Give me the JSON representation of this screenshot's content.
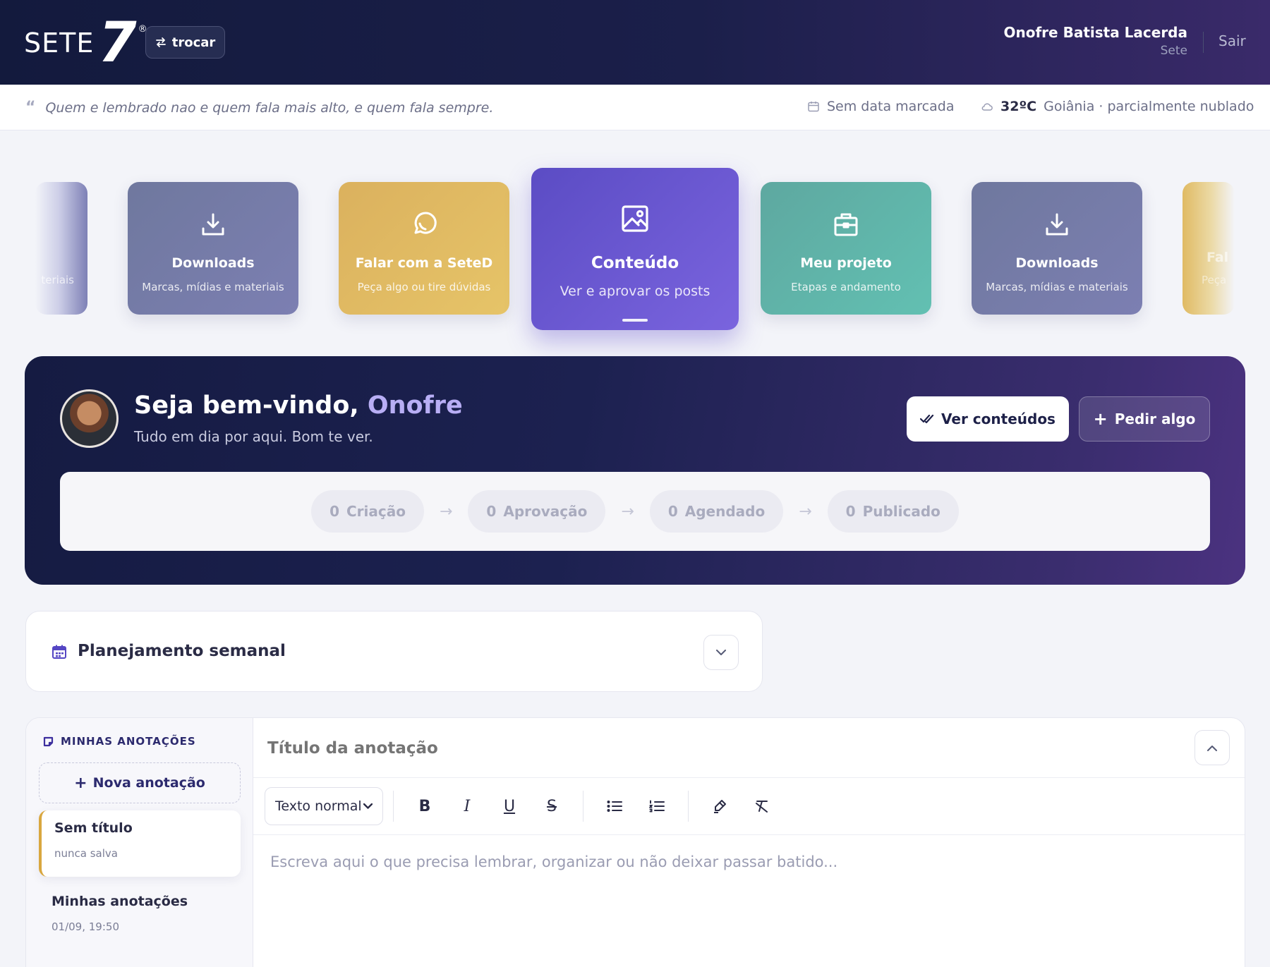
{
  "header": {
    "logo_text": "SETE",
    "logo_mark": "7",
    "logo_reg": "®",
    "switch_label": "trocar",
    "user_name": "Onofre Batista Lacerda",
    "user_company": "Sete",
    "logout_label": "Sair"
  },
  "info": {
    "quote": "Quem e lembrado nao e quem fala mais alto, e quem fala sempre.",
    "date": "Sem data marcada",
    "temperature": "32ºC",
    "weather": "Goiânia · parcialmente nublado"
  },
  "carousel": {
    "edge_left_sub": "teriais",
    "cards": [
      {
        "title": "Downloads",
        "subtitle": "Marcas, mídias e materiais",
        "icon": "download-icon",
        "color": "#737aa6"
      },
      {
        "title": "Falar com a SeteD",
        "subtitle": "Peça algo ou tire dúvidas",
        "icon": "whatsapp-icon",
        "color": "#e0bb63"
      },
      {
        "title": "Conteúdo",
        "subtitle": "Ver e aprovar os posts",
        "icon": "image-icon",
        "color": "#6a58d4"
      },
      {
        "title": "Meu projeto",
        "subtitle": "Etapas e andamento",
        "icon": "briefcase-icon",
        "color": "#5fb3a8"
      },
      {
        "title": "Downloads",
        "subtitle": "Marcas, mídias e materiais",
        "icon": "download-icon",
        "color": "#737aa6"
      }
    ],
    "edge_right_title": "Fal",
    "edge_right_sub": "Peça"
  },
  "hero": {
    "greeting": "Seja bem-vindo, ",
    "name": "Onofre",
    "subtitle": "Tudo em dia por aqui. Bom te ver.",
    "primary_button": "Ver conteúdos",
    "secondary_button": "Pedir algo",
    "pipeline": [
      {
        "count": "0",
        "label": "Criação"
      },
      {
        "count": "0",
        "label": "Aprovação"
      },
      {
        "count": "0",
        "label": "Agendado"
      },
      {
        "count": "0",
        "label": "Publicado"
      }
    ]
  },
  "planning": {
    "title": "Planejamento semanal"
  },
  "notes": {
    "section_title": "MINHAS ANOTAÇÕES",
    "new_note": "Nova anotação",
    "items": [
      {
        "title": "Sem título",
        "meta": "nunca salva"
      },
      {
        "title": "Minhas anotações",
        "meta": "01/09, 19:50"
      }
    ],
    "title_placeholder": "Título da anotação",
    "format_select": "Texto normal",
    "editor_placeholder": "Escreva aqui o que precisa lembrar, organizar ou não deixar passar batido..."
  },
  "colors": {
    "accent": "#6a58d4",
    "navy": "#151b42",
    "gold": "#d9a73f"
  }
}
